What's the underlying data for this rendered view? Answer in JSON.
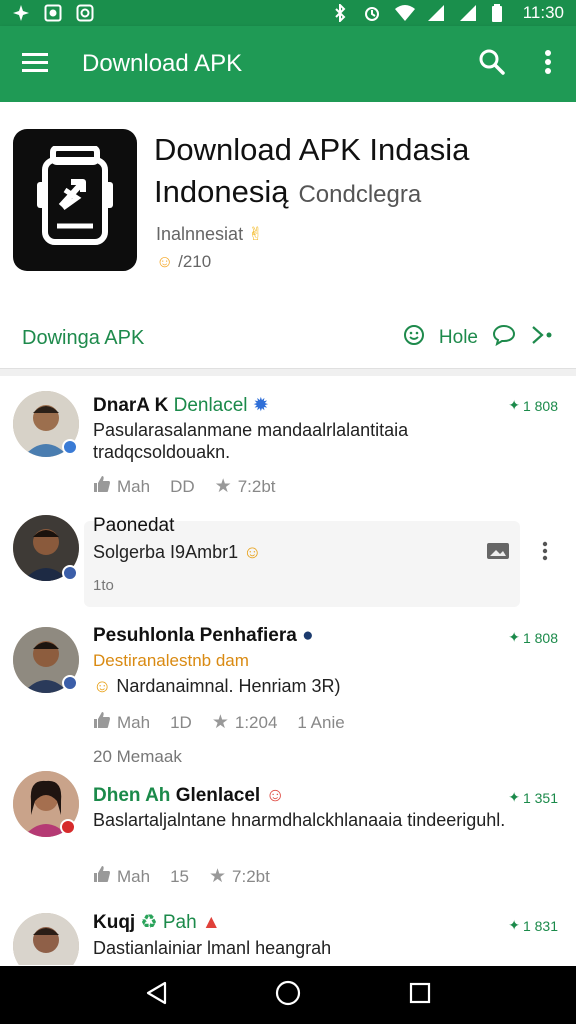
{
  "status_bar": {
    "time": "11:30"
  },
  "app_bar": {
    "title": "Download APK"
  },
  "app": {
    "name_line1": "Download APK Indasia",
    "name_line2": "Indonesią",
    "name_sub": "Condclegra",
    "developer": "Inalnnesiat",
    "rating_text": "/210"
  },
  "actions": {
    "main": "Dowinga APK",
    "more_label": "Hole"
  },
  "posts": [
    {
      "name": "DnarA K",
      "name_green": "Denlacel",
      "meta": "1 808",
      "text": "Pasularasalanmane mandaalrlalantitaia tradqcsoldouakn.",
      "likes": "Mah",
      "comments": "DD",
      "stars": "7:2bt"
    },
    {
      "name": "Paonedat",
      "text": "Solgerba I9Ambr1",
      "foot": "1to"
    },
    {
      "name": "Pesuhlonla Penhafiera",
      "meta": "1 808",
      "orange": "Destiranalestnb dam",
      "text": "Nardanaimnal. Henriam 3R)",
      "likes": "Mah",
      "comments": "1D",
      "stars": "1:204",
      "extra": "1 Anie",
      "foot": "20  Memaak"
    },
    {
      "name_green": "Dhen Ah",
      "name": "Glenlacel",
      "meta": "1 351",
      "text": "Baslartaljalntane hnarmdhalckhlanaaia tindeeriguhl.",
      "likes": "Mah",
      "comments": "15",
      "stars": "7:2bt"
    },
    {
      "name": "Kuqj",
      "name_green": "Pah",
      "meta": "1 831",
      "text": "Dastianlainiar lmanl heangrah"
    }
  ],
  "colors": {
    "primary": "#1f9a55",
    "status": "#1a8f4c",
    "accent_green": "#1b8a4a",
    "orange": "#d98a12"
  }
}
